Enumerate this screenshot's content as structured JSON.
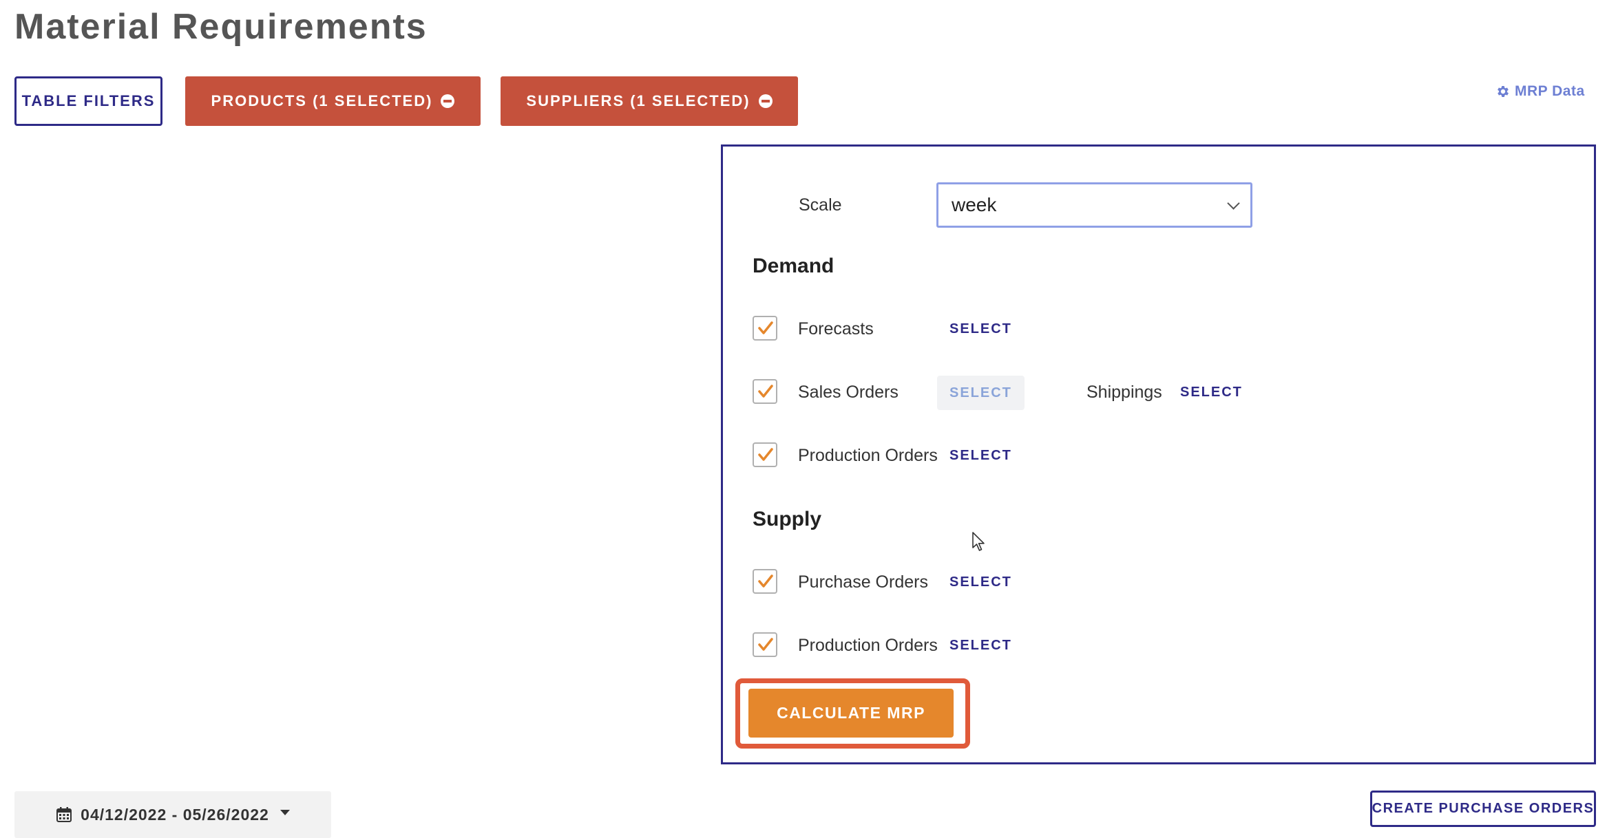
{
  "page": {
    "title": "Material Requirements"
  },
  "toolbar": {
    "table_filters_label": "TABLE FILTERS",
    "products_label": "PRODUCTS (1 SELECTED)",
    "suppliers_label": "SUPPLIERS (1 SELECTED)",
    "mrp_data_label": "MRP Data"
  },
  "panel": {
    "scale": {
      "label": "Scale",
      "value": "week"
    },
    "demand": {
      "title": "Demand",
      "items": [
        {
          "label": "Forecasts",
          "checked": true,
          "action": "SELECT"
        },
        {
          "label": "Sales Orders",
          "checked": true,
          "action": "SELECT",
          "extra_label": "Shippings",
          "extra_action": "SELECT"
        },
        {
          "label": "Production Orders",
          "checked": true,
          "action": "SELECT"
        }
      ]
    },
    "supply": {
      "title": "Supply",
      "items": [
        {
          "label": "Purchase Orders",
          "checked": true,
          "action": "SELECT"
        },
        {
          "label": "Production Orders",
          "checked": true,
          "action": "SELECT"
        }
      ]
    },
    "calculate_label": "CALCULATE MRP"
  },
  "footer": {
    "date_range": "04/12/2022 - 05/26/2022",
    "create_po_label": "CREATE PURCHASE ORDERS"
  },
  "colors": {
    "brand_navy": "#2e2a87",
    "danger_red": "#c5513c",
    "accent_orange": "#e5872c",
    "highlight_red": "#e05a3a",
    "link_blue": "#6d7fd3"
  }
}
